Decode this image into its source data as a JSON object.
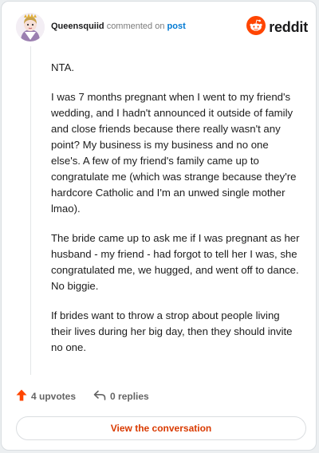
{
  "header": {
    "username": "Queensquiid",
    "action_text": "commented on",
    "post_link": "post",
    "brand": "reddit"
  },
  "comment": {
    "paragraphs": [
      "NTA.",
      "I was 7 months pregnant when I went to my friend's wedding, and I hadn't announced it outside of family and close friends because there really wasn't any point? My business is my business and no one else's. A few of my friend's family came up to congratulate me (which was strange because they're hardcore Catholic and I'm an unwed single mother lmao).",
      "The bride came up to ask me if I was pregnant as her husband - my friend - had forgot to tell her I was, she congratulated me, we hugged, and went off to dance. No biggie.",
      "If brides want to throw a strop about people living their lives during her big day, then they should invite no one."
    ]
  },
  "actions": {
    "upvotes": "4 upvotes",
    "replies": "0 replies"
  },
  "cta": {
    "label": "View the conversation"
  },
  "colors": {
    "brand_orange": "#ff4500",
    "link_blue": "#0079d3",
    "upvote_orange": "#ff4500",
    "cta_text": "#d93a00"
  },
  "icons": {
    "avatar": "user-avatar",
    "brand": "reddit-snoo-icon",
    "upvote": "upvote-arrow-icon",
    "reply": "reply-arrow-icon"
  }
}
